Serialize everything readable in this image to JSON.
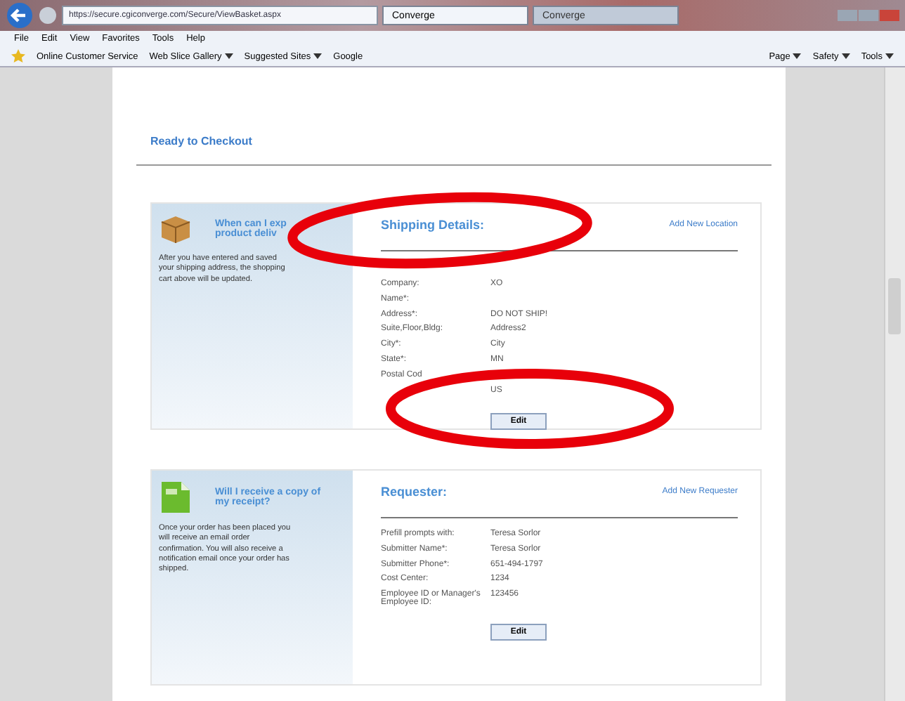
{
  "browser": {
    "address": "https://secure.cgiconverge.com/Secure/ViewBasket.aspx",
    "tabs": [
      {
        "label": "Converge",
        "selected": true
      },
      {
        "label": "Converge",
        "selected": false
      }
    ],
    "menu": [
      "File",
      "Edit",
      "View",
      "Favorites",
      "Tools",
      "Help"
    ],
    "favorites": [
      {
        "label": "Online Customer Service",
        "dropdown": false
      },
      {
        "label": "Web Slice Gallery",
        "dropdown": true
      },
      {
        "label": "Suggested Sites",
        "dropdown": true
      },
      {
        "label": "Google",
        "dropdown": false
      }
    ],
    "commands": [
      "Page",
      "Safety",
      "Tools"
    ]
  },
  "page": {
    "heading": "Ready to Checkout",
    "sections": [
      {
        "aside_title": [
          "When can I exp",
          "product deliv"
        ],
        "aside_text": "After you have entered and saved your shipping address, the shopping cart above will be updated.",
        "title": "Shipping Details:",
        "link": "Add New Location",
        "rows": [
          {
            "label": "Company:",
            "value": "XO"
          },
          {
            "label": "Name*:"
          },
          {
            "label": "Address*:",
            "value": "DO NOT SHIP!"
          },
          {
            "label": "Suite,Floor,Bldg:",
            "value": "Address2"
          },
          {
            "label": "City*:",
            "value": "City"
          },
          {
            "label": "State*:",
            "value": "MN"
          },
          {
            "label": "Postal Cod"
          },
          {
            "value": "US"
          }
        ],
        "button": "Edit"
      },
      {
        "aside_title": [
          "Will I receive a copy of",
          "my receipt?"
        ],
        "aside_text": "Once your order has been placed you will receive an email order confirmation. You will also receive a notification email once your order has shipped.",
        "title": "Requester:",
        "link": "Add New Requester",
        "rows": [
          {
            "label": "Prefill prompts with:",
            "value": "Teresa Sorlor"
          },
          {
            "label": "Submitter Name*:",
            "value": "Teresa Sorlor"
          },
          {
            "label": "Submitter Phone*:",
            "value": "651-494-1797"
          },
          {
            "label": "Cost Center:",
            "value": "1234"
          },
          {
            "label": "Employee ID or Manager's Employee ID:",
            "value": "123456"
          }
        ],
        "button": "Edit"
      }
    ]
  }
}
